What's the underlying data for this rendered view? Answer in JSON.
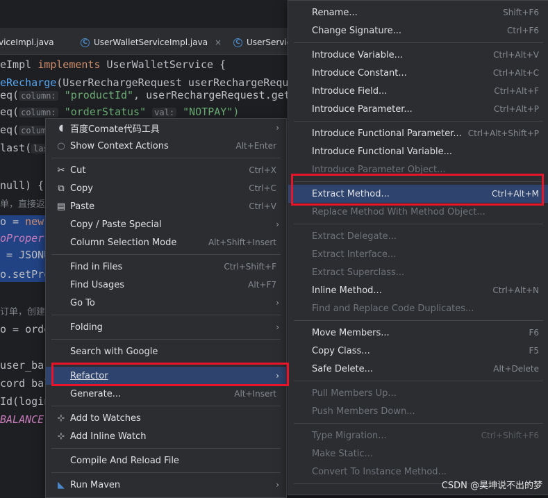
{
  "tabs": [
    {
      "label": "viceImpl.java",
      "icon": "class-icon"
    },
    {
      "label": "UserWalletServiceImpl.java",
      "icon": "class-icon",
      "close": "×"
    },
    {
      "label": "UserServic",
      "icon": "class-icon"
    }
  ],
  "code": {
    "l1_a": "eImpl ",
    "l1_kw": "implements",
    "l1_b": " UserWalletService {",
    "l2_fn": "eRecharge",
    "l2_b": "(UserRechargeRequest userRechargeReque",
    "l3_a": "eq(",
    "l3_hint": "column:",
    "l3_str": "\"productId\"",
    "l3_b": ", userRechargeRequest.get",
    "l4_a": "eq(",
    "l4_hint": "column:",
    "l4_str": "\"orderStatus\"",
    "l4_hint2": "val:",
    "l4_str2": "\"NOTPAY\")",
    "l5_a": "eq(",
    "l5_hint": "colum",
    "l6_a": "last(",
    "l6_hint": "las",
    "l7_a": "null) {",
    "l8_a": "单，直接返",
    "l9_a": "o = ",
    "l9_kw": "new",
    "l10_it": "oPropert",
    "l11_a": " = JSONU",
    "l12_a": "o.setPro",
    "l13_a": "订单，创建",
    "l14_a": "o = orde",
    "l15_a": "user_ba",
    "l16_a": "cord bal",
    "l17_a": "Id(login",
    "l18_it": "BALANCE"
  },
  "context_menu": {
    "items": [
      {
        "label": "百度Comate代码工具",
        "icon": "comate-icon",
        "submenu": true
      },
      {
        "label": "Show Context Actions",
        "icon": "bulb-icon",
        "shortcut": "Alt+Enter"
      },
      {
        "label": "Cut",
        "icon": "scissors-icon",
        "shortcut": "Ctrl+X"
      },
      {
        "label": "Copy",
        "icon": "copy-icon",
        "shortcut": "Ctrl+C"
      },
      {
        "label": "Paste",
        "icon": "paste-icon",
        "shortcut": "Ctrl+V"
      },
      {
        "label": "Copy / Paste Special",
        "submenu": true
      },
      {
        "label": "Column Selection Mode",
        "shortcut": "Alt+Shift+Insert"
      },
      {
        "label": "Find in Files",
        "shortcut": "Ctrl+Shift+F"
      },
      {
        "label": "Find Usages",
        "shortcut": "Alt+F7"
      },
      {
        "label": "Go To",
        "submenu": true
      },
      {
        "label": "Folding",
        "submenu": true
      },
      {
        "label": "Search with Google"
      },
      {
        "label": "Refactor",
        "submenu": true,
        "selected": true
      },
      {
        "label": "Generate...",
        "shortcut": "Alt+Insert"
      },
      {
        "label": "Add to Watches",
        "icon": "watch-add-icon"
      },
      {
        "label": "Add Inline Watch",
        "icon": "watch-add-icon"
      },
      {
        "label": "Compile And Reload File"
      },
      {
        "label": "Run Maven",
        "icon": "maven-icon",
        "submenu": true
      }
    ]
  },
  "refactor_menu": {
    "items": [
      {
        "label": "Rename...",
        "shortcut": "Shift+F6"
      },
      {
        "label": "Change Signature...",
        "shortcut": "Ctrl+F6"
      },
      {
        "label": "Introduce Variable...",
        "shortcut": "Ctrl+Alt+V"
      },
      {
        "label": "Introduce Constant...",
        "shortcut": "Ctrl+Alt+C"
      },
      {
        "label": "Introduce Field...",
        "shortcut": "Ctrl+Alt+F"
      },
      {
        "label": "Introduce Parameter...",
        "shortcut": "Ctrl+Alt+P"
      },
      {
        "label": "Introduce Functional Parameter...",
        "shortcut": "Ctrl+Alt+Shift+P"
      },
      {
        "label": "Introduce Functional Variable..."
      },
      {
        "label": "Introduce Parameter Object...",
        "disabled": true
      },
      {
        "label": "Extract Method...",
        "shortcut": "Ctrl+Alt+M",
        "selected": true
      },
      {
        "label": "Replace Method With Method Object...",
        "disabled": true
      },
      {
        "label": "Extract Delegate...",
        "disabled": true
      },
      {
        "label": "Extract Interface...",
        "disabled": true
      },
      {
        "label": "Extract Superclass...",
        "disabled": true
      },
      {
        "label": "Inline Method...",
        "shortcut": "Ctrl+Alt+N"
      },
      {
        "label": "Find and Replace Code Duplicates...",
        "disabled": true
      },
      {
        "label": "Move Members...",
        "shortcut": "F6"
      },
      {
        "label": "Copy Class...",
        "shortcut": "F5"
      },
      {
        "label": "Safe Delete...",
        "shortcut": "Alt+Delete"
      },
      {
        "label": "Pull Members Up...",
        "disabled": true
      },
      {
        "label": "Push Members Down...",
        "disabled": true
      },
      {
        "label": "Type Migration...",
        "shortcut": "Ctrl+Shift+F6",
        "disabled": true
      },
      {
        "label": "Make Static...",
        "disabled": true
      },
      {
        "label": "Convert To Instance Method...",
        "disabled": true
      }
    ]
  },
  "watermark": "CSDN @昊坤说不出的梦",
  "colors": {
    "highlight": "#e8152a",
    "selection": "#2e436e"
  }
}
